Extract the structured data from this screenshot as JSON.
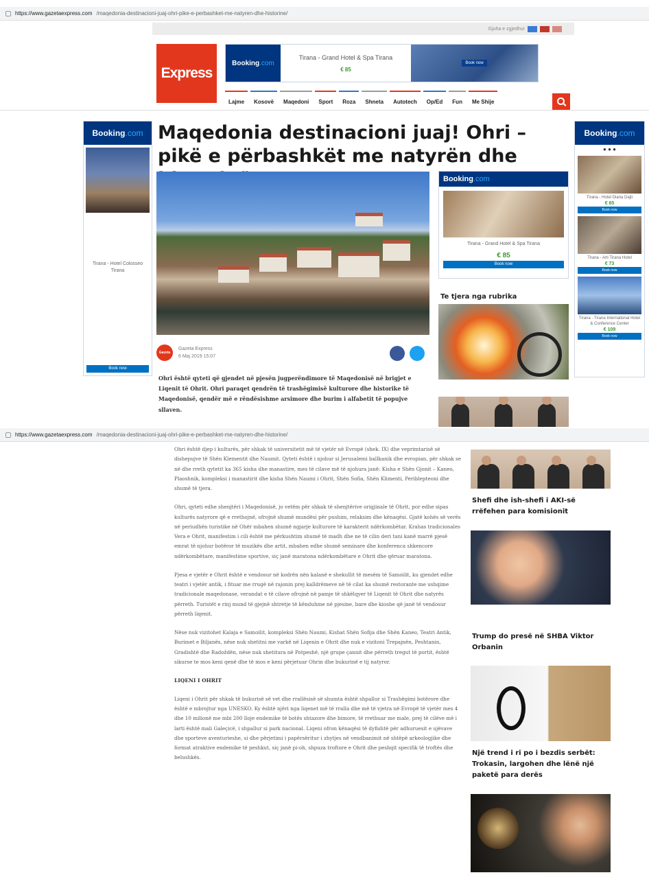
{
  "browser": {
    "url_domain": "https://www.gazetaexpress.com",
    "url_path": "/maqedonia-destinacioni-juaj-ohri-pike-e-perbashket-me-natyren-dhe-historine/"
  },
  "header": {
    "lang_label": "Gjuha e zgjedhur",
    "logo_text": "Express",
    "top_ad": {
      "brand_main": "Booking",
      "brand_tld": ".com",
      "hotel": "Tirana - Grand Hotel & Spa Tirana",
      "price": "€ 85",
      "button": "Book now"
    },
    "nav": [
      "Lajme",
      "Kosovë",
      "Maqedoni",
      "Sport",
      "Roza",
      "Shneta",
      "Autotech",
      "Op/Ed",
      "Fun",
      "Me Shije"
    ]
  },
  "left_ad": {
    "brand_main": "Booking",
    "brand_tld": ".com",
    "hotel": "Tirana - Hotel Colosseo Tirana",
    "button": "Book now"
  },
  "right_ad": {
    "brand_main": "Booking",
    "brand_tld": ".com",
    "dots": "● ● ●",
    "items": [
      {
        "name": "Tirana - Hotel Diana Dajti",
        "price": "€ 65",
        "button": "Book now"
      },
      {
        "name": "Tirana - Arti Tirana Hotel",
        "price": "€ 73",
        "button": "Book now"
      },
      {
        "name": "Tirana - Tirana International Hotel & Conference Center",
        "price": "€ 109",
        "button": "Book now"
      }
    ]
  },
  "article": {
    "title": "Maqedonia destinacioni juaj! Ohri – pikë e përbashkët me natyrën dhe historinë",
    "author": "Gazeta Express",
    "date": "6 Maj 2019 15:07",
    "avatar_text": "Gazeta",
    "lead": "Ohri është qyteti që gjendet në pjesën jugperëndimore të Maqedonisë në brigjet e Liqenit të Ohrit. Ohri paraqet qendrën të trashëgimisë kulturore dhe historike të Maqedonisë, qendër më e rëndësishme arsimore dhe burim i alfabetit të popujve sllaven.",
    "paragraphs": [
      "Ohri është djep i kulturës, për shkak të universitetit më të vjetër në Evropë (shek. IX) dhe veprimtarisë së dishepujve të Shën Klementit dhe Naumit. Qyteti është i njohur si Jerusalemi ballkanik dhe evropian, për shkak se në dhe rreth qytetit ka 365 kisha dhe manastire, mes të cilave më të njohura janë: Kisha e Shën Gjonit – Kaneo, Plaoshnik, kompleksi i manastirit dhe kisha Shën Naumi i Ohrit, Shën Sofia, Shën Klimenti, Periblepteoni dhe shumë të tjera.",
      "Ohri, qyteti edhe shenjtëri i Maqedonisë, jo vetëm për shkak të shenjtërive origjinale të Ohrit, por edhe sipas kulturës natyrore që e rrethojnë, ofrojnë shumë mundësi për pushim, relaksim dhe kënaqësi. Gjatë kohës së verës në periudhën turistike në Ohër mbahen shumë ngjarje kulturore të karakterit ndërkombëtar. Krahas tradicionales Vera e Ohrit, manifestim i cili është me përkushtim shumë të madh dhe ne të cilin deri tani kanë marrë pjesë emrat të njohur botëror të muzikës dhe artit, mbahen edhe shumë seminare dhe konferenca shkencore ndërkombëtare, manifestime sportive, siç janë maratona ndërkombëtare e Ohrit dhe qëruar maratona.",
      "Pjesa e vjetër e Ohrit është e vendosur në kodrën nën kalanë e shekullit të mesëm të Samoilit, ku gjendet edhe teatri i vjetër antik, i fituar me rrugë në rajonin prej kalldrëmeve në të cilat ka shumë restorante me ushqime tradicionale maqedonase, verandat e të cilave ofrojnë në pamje të shkëlqyer të Liqenit të Ohrit dhe natyrës përreth. Turistët e rinj mund të gjejnë shtretje të kënduhme në pjesine, bare dhe kioshe që janë të vendosur përreth liqenit.",
      "Nëse nuk vizitohet Kalaja e Samoilit, kompleksi Shën Naumi, Kishat Shën Sofija dhe Shën Kaneo, Teatri Antik, Burimet e Biljanës, nëse nuk shetitni me varkë në Liqenin e Ohrit dhe nuk e vizitoni Trepajnën, Peshtanin, Gradishtë dhe Radoždën, nëse nuk shetitura në Potpeshë, një grupe çannit dhe përreth tregut të portit, është sikurse te mos keni qenë dhe të mos e keni përjetuar Ohrin dhe bukurinë e tij natyror."
    ],
    "section_heading": "LIQENI I OHRIT",
    "paragraph_last": "Liqeni i Ohrit për shkak të bukurisë së vet dhe rrallësisë së shumta është shpallur si Trashëgimi botërore dhe është e mbrojtur nga UNESKO. Ky është njëri nga liqenet më të rralla dhe më të vjetra në Evropë të vjetër mes 4 dhe 10 milionë me mbi 200 lloje endemike të botës shtazore dhe bimore, të rrethuar me male, prej të cilëve më i larti është mali Galeçicë, i shpallur si park nacional. Liqeni ofron kënaqësi të dyfishtë për adhuruesit e ujëvave dhe sporteve aventurieshe, si dhe përjetimi i papërsëritur i zhytjes në vendbanimit në shtëpë arkeologjike dhe format atraktive endemike të peshkut, siç janë pi-oh, shpuza troftore e Ohrit dhe peshqit specifik të troftës dhe belushkës."
  },
  "sidebar": {
    "mid_ad": {
      "brand_main": "Booking",
      "brand_tld": ".com",
      "hotel": "Tirana - Grand Hotel & Spa Tirana",
      "price": "€ 85",
      "button": "Book now"
    },
    "rubrika_title": "Te tjera nga rubrika",
    "stories": [
      "Shefi dhe ish-shefi i AKI-së rrëfehen para komisionit",
      "Trump do presë në SHBA Viktor Orbanin",
      "Një trend i ri po i bezdis serbët: Trokasin, largohen dhe lënë një paketë para derës"
    ]
  },
  "colors": {
    "brand_red": "#e3371d",
    "booking_blue": "#003580",
    "book_button": "#0071c2",
    "price_green": "#3a9a2f"
  }
}
